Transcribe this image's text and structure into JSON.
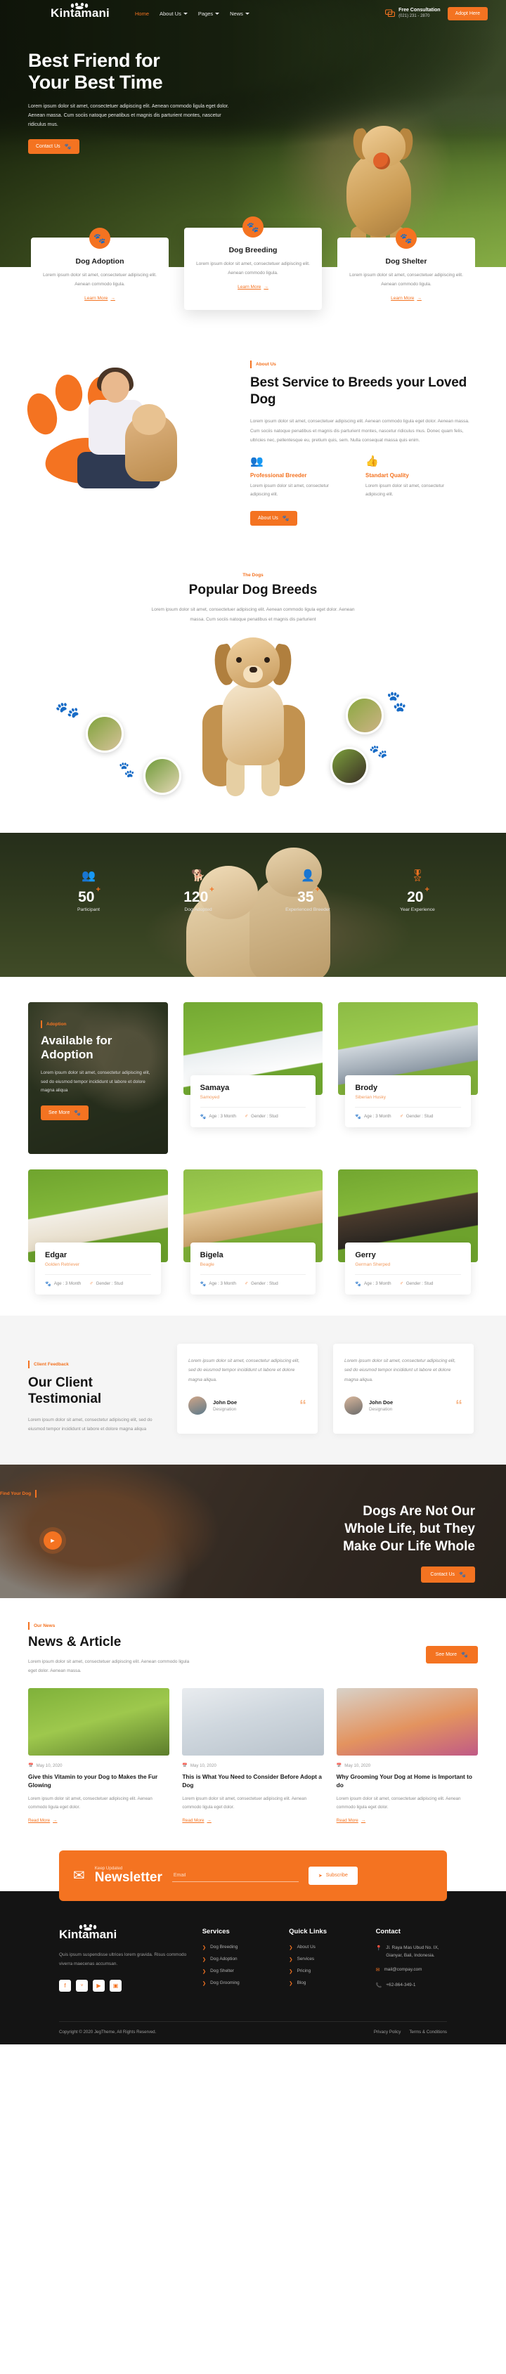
{
  "brand": {
    "name": "Kintamani"
  },
  "nav": {
    "items": [
      {
        "label": "Home",
        "active": true,
        "caret": false
      },
      {
        "label": "About Us",
        "active": false,
        "caret": true
      },
      {
        "label": "Pages",
        "active": false,
        "caret": true
      },
      {
        "label": "News",
        "active": false,
        "caret": true
      }
    ],
    "consultation": {
      "icon": "chat-icon",
      "title": "Free Consultation",
      "phone": "(021) 231 - 2870"
    },
    "cta_label": "Adopt Here"
  },
  "hero": {
    "title_line1": "Best Friend for",
    "title_line2": "Your Best Time",
    "paragraph": "Lorem ipsum dolor sit amet, consectetuer adipiscing elit. Aenean commodo ligula eget dolor. Aenean massa. Cum sociis natoque penatibus et magnis dis parturient montes, nascetur ridiculus mus.",
    "cta_label": "Contact Us"
  },
  "services": [
    {
      "icon": "paw-icon",
      "title": "Dog Adoption",
      "text": "Lorem ipsum dolor sit amet, consectetuer adipiscing elit. Aenean commodo ligula.",
      "link": "Learn More"
    },
    {
      "icon": "paw-icon",
      "title": "Dog Breeding",
      "text": "Lorem ipsum dolor sit amet, consectetuer adipiscing elit. Aenean commodo ligula.",
      "link": "Learn More"
    },
    {
      "icon": "paw-icon",
      "title": "Dog Shelter",
      "text": "Lorem ipsum dolor sit amet, consectetuer adipiscing elit. Aenean commodo ligula.",
      "link": "Learn More"
    }
  ],
  "about": {
    "tagline": "About Us",
    "title": "Best Service to Breeds your Loved Dog",
    "paragraph": "Lorem ipsum dolor sit amet, consectetuer adipiscing elit. Aenean commodo ligula eget dolor. Aenean massa. Cum sociis natoque penatibus et magnis dis parturient montes, nascetur ridiculus mus. Donec quam felis, ultricies nec, pellentesque eu, pretium quis, sem. Nulla consequat massa quis enim.",
    "features": [
      {
        "icon": "group-icon",
        "title": "Professional Breeder",
        "text": "Lorem ipsum dolor sit amet, consectetur adipiscing elit."
      },
      {
        "icon": "badge-thumb-icon",
        "title": "Standart Quality",
        "text": "Lorem ipsum dolor sit amet, consectetur adipiscing elit."
      }
    ],
    "cta_label": "About Us"
  },
  "breeds": {
    "tagline": "The Dogs",
    "title": "Popular Dog Breeds",
    "subtitle": "Lorem ipsum dolor sit amet, consectetuer adipiscing elit. Aenean commodo ligula eget dolor. Aenean massa. Cum sociis natoque penatibus et magnis dis parturient"
  },
  "stats": [
    {
      "icon": "people-icon",
      "value": "50",
      "plus": "+",
      "label": "Participant"
    },
    {
      "icon": "dog-icon",
      "value": "120",
      "plus": "+",
      "label": "Dog Adopted"
    },
    {
      "icon": "person-check-icon",
      "value": "35",
      "plus": "+",
      "label": "Experienced Breeder"
    },
    {
      "icon": "award-icon",
      "value": "20",
      "plus": "+",
      "label": "Year Experience"
    }
  ],
  "adoption": {
    "promo": {
      "tagline": "Adoption",
      "title": "Available for Adoption",
      "paragraph": "Lorem ipsum dolor sit amet, consectetur adipiscing elit, sed do eiusmod tempor incididunt ut labore et dolore magna aliqua",
      "cta_label": "See More"
    },
    "meta_labels": {
      "age_icon": "paw-icon",
      "gender_icon": "gender-icon"
    },
    "dogs": [
      {
        "name": "Samaya",
        "breed": "Samoyed",
        "age": "Age : 3 Month",
        "gender": "Gender : Stud"
      },
      {
        "name": "Brody",
        "breed": "Siberian Husky",
        "age": "Age : 3 Month",
        "gender": "Gender : Stud"
      },
      {
        "name": "Edgar",
        "breed": "Golden Retriever",
        "age": "Age : 3 Month",
        "gender": "Gender : Stud"
      },
      {
        "name": "Bigela",
        "breed": "Beagle",
        "age": "Age : 3 Month",
        "gender": "Gender : Stud"
      },
      {
        "name": "Gerry",
        "breed": "German Sherped",
        "age": "Age : 3 Month",
        "gender": "Gender : Stud"
      }
    ]
  },
  "testimonial": {
    "tagline": "Client Feedback",
    "title": "Our Client Testimonial",
    "paragraph": "Lorem ipsum dolor sit amet, consectetur adipiscing elit, sed do eiusmod tempor incididunt ut labore et dolore magna aliqua",
    "cards": [
      {
        "quote": "Lorem ipsum dolor sit amet, consectetur adipiscing elit, sed do eiusmod tempor incididunt ut labore et dolore magna aliqua.",
        "name": "John Doe",
        "role": "Designation"
      },
      {
        "quote": "Lorem ipsum dolor sit amet, consectetur adipiscing elit, sed do eiusmod tempor incididunt ut labore et dolore magna aliqua.",
        "name": "John Doe",
        "role": "Designation"
      }
    ]
  },
  "cta": {
    "tagline": "Find Your Dog",
    "title_line1": "Dogs Are Not Our",
    "title_line2": "Whole Life, but They",
    "title_line3": "Make Our Life Whole",
    "button_label": "Contact Us",
    "play_icon": "play-icon"
  },
  "news": {
    "tagline": "Our News",
    "title": "News & Article",
    "paragraph": "Lorem ipsum dolor sit amet, consectetuer adipiscing elit. Aenean commodo ligula eget dolor. Aenean massa.",
    "see_more": "See More",
    "articles": [
      {
        "date": "May 10, 2020",
        "title": "Give this Vitamin to your Dog to Makes the Fur Glowing",
        "text": "Lorem ipsum dolor sit amet, consectetuer adipiscing elit. Aenean commodo ligula eget dolor.",
        "link": "Read More"
      },
      {
        "date": "May 10, 2020",
        "title": "This is What You Need to Consider Before Adopt a Dog",
        "text": "Lorem ipsum dolor sit amet, consectetuer adipiscing elit. Aenean commodo ligula eget dolor.",
        "link": "Read More"
      },
      {
        "date": "May 10, 2020",
        "title": "Why Grooming Your Dog at Home is Important to do",
        "text": "Lorem ipsum dolor sit amet, consectetuer adipiscing elit. Aenean commodo ligula eget dolor.",
        "link": "Read More"
      }
    ]
  },
  "newsletter": {
    "icon": "mail-icon",
    "small": "Keep Updated",
    "title": "Newsletter",
    "placeholder": "Email",
    "button_label": "Subscribe"
  },
  "footer": {
    "brand": "Kintamani",
    "about": "Quis ipsum suspendisse ultrices lorem gravida. Risus commodo viverra maecenas accumsan.",
    "socials": [
      {
        "icon": "facebook-icon",
        "glyph": "f"
      },
      {
        "icon": "twitter-icon",
        "glyph": "ᵛ"
      },
      {
        "icon": "youtube-icon",
        "glyph": "▶"
      },
      {
        "icon": "instagram-icon",
        "glyph": "▣"
      }
    ],
    "services": {
      "title": "Services",
      "items": [
        "Dog Breeding",
        "Dog Adoption",
        "Dog Shelter",
        "Dog Grooming"
      ]
    },
    "quick_links": {
      "title": "Quick Links",
      "items": [
        "About Us",
        "Services",
        "Pricing",
        "Blog"
      ]
    },
    "contact": {
      "title": "Contact",
      "address": "Jl. Raya Mas Ubud No. IX, Gianyar, Bali, Indonesia.",
      "email": "mail@compay.com",
      "phone": "+62-864-349-1"
    },
    "copyright": "Copyright © 2020 JegTheme, All Rights Reserved.",
    "legal": [
      "Privacy Policy",
      "Terms & Conditions"
    ]
  },
  "colors": {
    "accent": "#f47321",
    "dark": "#141414",
    "muted": "#8c8c8c"
  }
}
